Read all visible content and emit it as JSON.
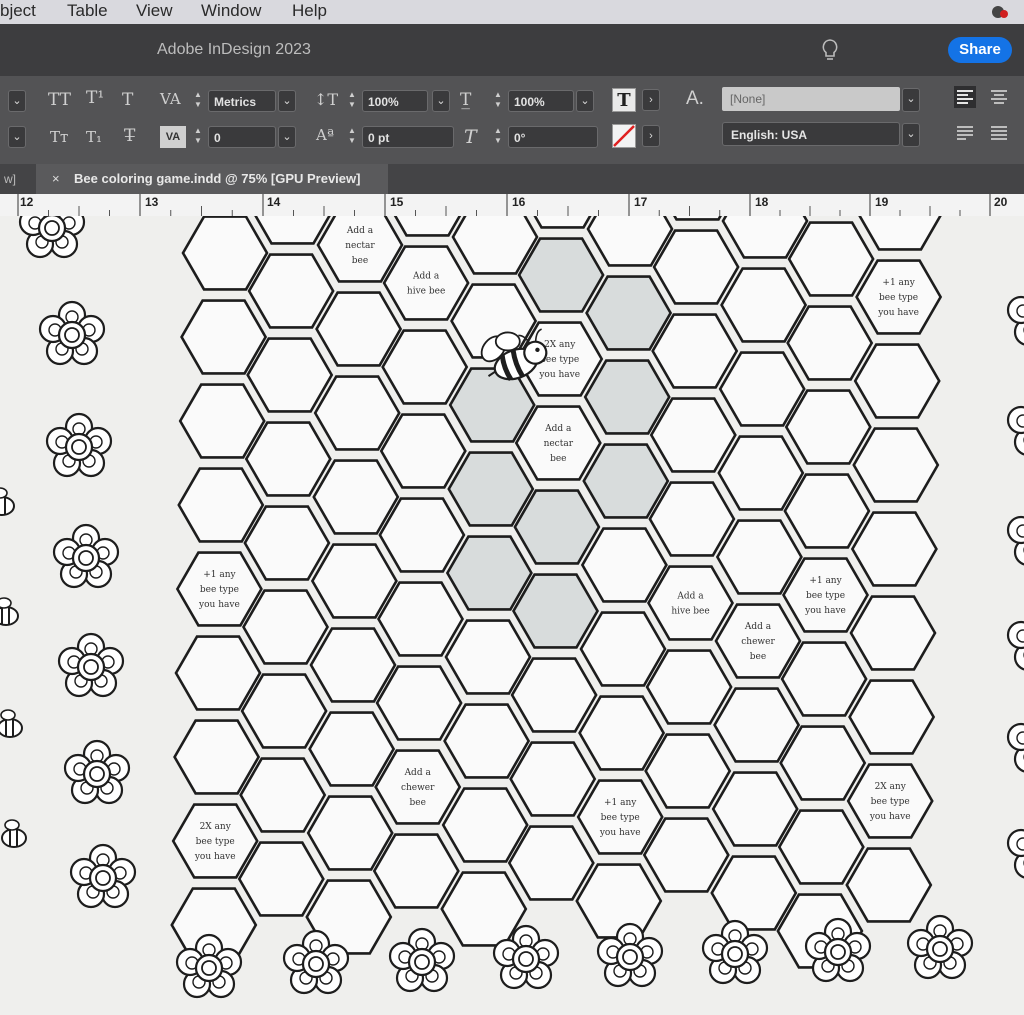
{
  "menu": {
    "items": [
      "bject",
      "Table",
      "View",
      "Window",
      "Help"
    ]
  },
  "app": {
    "title": "Adobe InDesign 2023",
    "share_label": "Share",
    "accent": "#1473e6"
  },
  "control_panel": {
    "kerning": "Metrics",
    "vertical_scale": "100%",
    "horizontal_scale": "100%",
    "tracking": "0",
    "baseline_shift": "0 pt",
    "skew": "0°",
    "char_style": "[None]",
    "language": "English: USA",
    "a_label": "A."
  },
  "document_tab": {
    "left_label": "w]",
    "close": "×",
    "label": "Bee coloring game.indd @ 75% [GPU Preview]"
  },
  "ruler": {
    "labels": [
      "12",
      "13",
      "14",
      "15",
      "16",
      "17",
      "18",
      "19",
      "20"
    ]
  },
  "board": {
    "cell_labels": {
      "nectar": [
        "Add a",
        "nectar",
        "bee"
      ],
      "hive": [
        "Add a",
        "hive bee"
      ],
      "chewer": [
        "Add a",
        "chewer",
        "bee"
      ],
      "plus_any": [
        "+1 any",
        "bee type",
        "you have"
      ],
      "two_x_any": [
        "2X any",
        "bee type",
        "you have"
      ]
    },
    "shaded_color": "#d8dcdc",
    "line_color": "#1d1d1d"
  }
}
